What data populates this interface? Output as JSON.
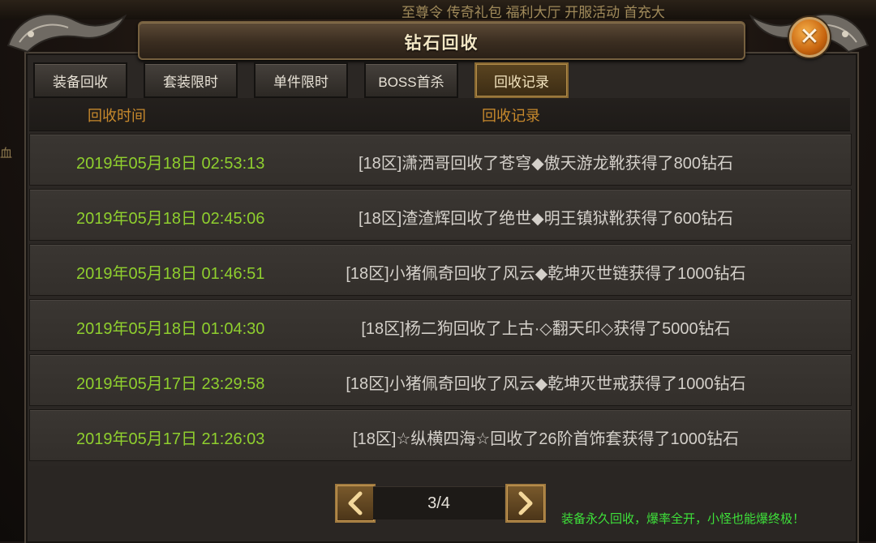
{
  "window": {
    "title": "钻石回收",
    "close_glyph": "✕"
  },
  "background": {
    "top_links": "至尊令  传奇礼包 福利大厅 开服活动 首充大",
    "side_text": "血"
  },
  "tabs": [
    {
      "label": "装备回收",
      "active": false
    },
    {
      "label": "套装限时",
      "active": false
    },
    {
      "label": "单件限时",
      "active": false
    },
    {
      "label": "BOSS首杀",
      "active": false
    },
    {
      "label": "回收记录",
      "active": true
    }
  ],
  "table": {
    "columns": [
      "回收时间",
      "回收记录"
    ],
    "rows": [
      {
        "time": "2019年05月18日 02:53:13",
        "record": "[18区]潇洒哥回收了苍穹◆傲天游龙靴获得了800钻石"
      },
      {
        "time": "2019年05月18日 02:45:06",
        "record": "[18区]渣渣辉回收了绝世◆明王镇狱靴获得了600钻石"
      },
      {
        "time": "2019年05月18日 01:46:51",
        "record": "[18区]小猪佩奇回收了风云◆乾坤灭世链获得了1000钻石"
      },
      {
        "time": "2019年05月18日 01:04:30",
        "record": "[18区]杨二狗回收了上古·◇翻天印◇获得了5000钻石"
      },
      {
        "time": "2019年05月17日 23:29:58",
        "record": "[18区]小猪佩奇回收了风云◆乾坤灭世戒获得了1000钻石"
      },
      {
        "time": "2019年05月17日 21:26:03",
        "record": "[18区]☆纵横四海☆回收了26阶首饰套获得了1000钻石"
      }
    ]
  },
  "pagination": {
    "current": "3/4",
    "prev_icon": "chevron-left-icon",
    "next_icon": "chevron-right-icon"
  },
  "slogan": "装备永久回收，爆率全开，小怪也能爆终极！",
  "colors": {
    "time_text": "#8fcf2e",
    "header_text": "#c7892c",
    "slogan_text": "#3ee03a",
    "close_button": "#e07a18"
  }
}
